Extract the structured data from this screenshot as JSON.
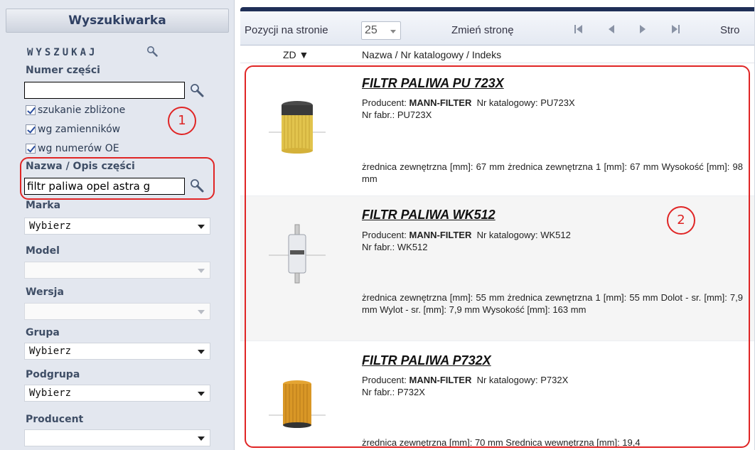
{
  "sidebar": {
    "header": "Wyszukiwarka",
    "search_title": "WYSZUKAJ",
    "part_number_label": "Numer części",
    "part_number_value": "",
    "checkboxes": [
      {
        "label": "szukanie zbliżone",
        "checked": true
      },
      {
        "label": "wg zamienników",
        "checked": true
      },
      {
        "label": "wg numerów OE",
        "checked": true
      }
    ],
    "name_desc_label": "Nazwa / Opis części",
    "name_desc_value": "filtr paliwa opel astra g",
    "brand_label": "Marka",
    "brand_value": "Wybierz",
    "model_label": "Model",
    "model_value": "",
    "version_label": "Wersja",
    "version_value": "",
    "group_label": "Grupa",
    "group_value": "Wybierz",
    "subgroup_label": "Podgrupa",
    "subgroup_value": "Wybierz",
    "producer_label": "Producent",
    "producer_value": ""
  },
  "annotations": {
    "circle1": "1",
    "circle2": "2",
    "accent_color": "#e02525"
  },
  "toolbar": {
    "per_page_label": "Pozycji na stronie",
    "per_page_value": "25",
    "change_page_label": "Zmień stronę",
    "page_label": "Stro"
  },
  "columns": {
    "zd": "ZD ▼",
    "nazwa": "Nazwa  / Nr katalogowy  / Indeks"
  },
  "products": [
    {
      "title": "FILTR PALIWA PU 723X",
      "producer_label": "Producent:",
      "producer": "MANN-FILTER",
      "catalog_label": "Nr katalogowy:",
      "catalog": "PU723X",
      "fabr_label": "Nr fabr.:",
      "fabr": "PU723X",
      "desc": "żrednica zewnętrzna [mm]: 67 mm żrednica zewnętrzna 1 [mm]: 67 mm Wysokość [mm]: 98 mm"
    },
    {
      "title": "FILTR PALIWA WK512",
      "producer_label": "Producent:",
      "producer": "MANN-FILTER",
      "catalog_label": "Nr katalogowy:",
      "catalog": "WK512",
      "fabr_label": "Nr fabr.:",
      "fabr": "WK512",
      "desc": "żrednica zewnętrzna [mm]: 55 mm żrednica zewnętrzna 1 [mm]: 55 mm Dolot - sr. [mm]: 7,9 mm Wylot - sr. [mm]: 7,9 mm Wysokość [mm]: 163 mm"
    },
    {
      "title": "FILTR PALIWA P732X",
      "producer_label": "Producent:",
      "producer": "MANN-FILTER",
      "catalog_label": "Nr katalogowy:",
      "catalog": "P732X",
      "fabr_label": "Nr fabr.:",
      "fabr": "P732X",
      "desc": "żrednica zewnętrzna [mm]: 70 mm Srednica wewnętrzna [mm]: 19,4"
    }
  ]
}
